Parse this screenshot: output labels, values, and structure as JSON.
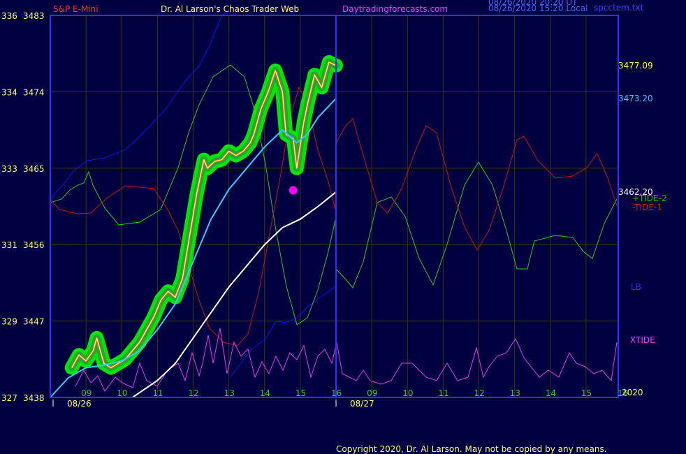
{
  "header": {
    "symbol": "S&P E-Mini",
    "title": "Dr. Al Larson's Chaos Trader Web",
    "site": "Daytradingforecasts.com",
    "stamp_line1": "08/26/2020 20:20 UT",
    "stamp_line2": "08/26/2020 15:20 Local",
    "file": "spcctem.txt"
  },
  "copyright": "Copyright 2020, Dr. Al Larson. May not be copied by any means.",
  "colors": {
    "background": "#000040",
    "plot_border": "#3030ff",
    "price": "#ffff00",
    "price_highlight": "#00ff00",
    "price_core": "#cc44cc",
    "average_cyan": "#33ccff",
    "average_white": "#ffffff",
    "channel": "#0000ff",
    "tide_plus": "#00cc00",
    "tide_minus": "#cc0000",
    "xtide": "#ff33ff",
    "marker": "#ff00ff"
  },
  "chart_data": {
    "type": "line",
    "x_unit": "hour (days 08/26 and 08/27)",
    "y_left_labels": [
      {
        "value": 3483,
        "code": "336"
      },
      {
        "value": 3474,
        "code": "334"
      },
      {
        "value": 3465,
        "code": "333"
      },
      {
        "value": 3456,
        "code": "331"
      },
      {
        "value": 3447,
        "code": "329"
      },
      {
        "value": 3438,
        "code": "327"
      }
    ],
    "ylim": [
      3438,
      3483
    ],
    "grid": true,
    "x_ticks_day1": [
      "09",
      "10",
      "11",
      "12",
      "13",
      "14",
      "15",
      "16"
    ],
    "x_ticks_day2": [
      "09",
      "10",
      "11",
      "12",
      "13",
      "14",
      "15",
      "16"
    ],
    "dates": [
      "08/26",
      "08/27"
    ],
    "right_labels": [
      {
        "text": "3477.09",
        "value": 3477.09,
        "color": "#ffff00"
      },
      {
        "text": "3473.20",
        "value": 3473.2,
        "color": "#33ccff"
      },
      {
        "text": "3462.20",
        "value": 3462.2,
        "color": "#ffffff"
      }
    ],
    "legend": [
      {
        "name": "+TIDE-2",
        "color": "#00cc00"
      },
      {
        "name": "-TIDE-1",
        "color": "#cc0000"
      },
      {
        "name": "LB",
        "color": "#0000ff"
      },
      {
        "name": "XTIDE",
        "color": "#ff33ff"
      }
    ],
    "year_label": "2020",
    "series": [
      {
        "name": "S&P E-Mini",
        "x": [
          8.6,
          8.8,
          9.0,
          9.2,
          9.3,
          9.5,
          9.7,
          9.9,
          10.1,
          10.3,
          10.5,
          10.7,
          10.9,
          11.1,
          11.3,
          11.5,
          11.7,
          11.9,
          12.1,
          12.3,
          12.4,
          12.6,
          12.8,
          13.0,
          13.2,
          13.4,
          13.6,
          13.7,
          13.9,
          14.1,
          14.3,
          14.5,
          14.6,
          14.8,
          14.9,
          15.1,
          15.2,
          15.4,
          15.6,
          15.8,
          16.0
        ],
        "y": [
          3441.5,
          3443.0,
          3442.3,
          3443.5,
          3445.0,
          3442.0,
          3441.5,
          3442.0,
          3442.5,
          3443.5,
          3444.5,
          3446.0,
          3447.5,
          3449.5,
          3450.5,
          3449.8,
          3452.0,
          3457.0,
          3462.0,
          3466.0,
          3465.0,
          3465.8,
          3466.0,
          3467.0,
          3466.5,
          3467.0,
          3468.0,
          3469.0,
          3472.0,
          3474.0,
          3476.5,
          3474.0,
          3469.0,
          3468.5,
          3465.0,
          3470.5,
          3472.5,
          3476.0,
          3474.5,
          3477.5,
          3477.1
        ]
      },
      {
        "name": "Cyan average",
        "x": [
          8.0,
          8.5,
          9.0,
          9.5,
          10.0,
          10.5,
          11.0,
          11.5,
          12.0,
          12.5,
          13.0,
          13.5,
          14.0,
          14.5,
          14.9,
          15.2,
          15.5,
          16.0
        ],
        "y": [
          3438.0,
          3440.3,
          3441.5,
          3441.8,
          3442.3,
          3443.5,
          3446.0,
          3449.0,
          3454.0,
          3459.0,
          3462.5,
          3465.0,
          3467.5,
          3469.5,
          3468.0,
          3469.0,
          3471.0,
          3473.2
        ]
      },
      {
        "name": "White average",
        "x": [
          10.3,
          11.0,
          11.5,
          12.0,
          12.5,
          13.0,
          13.5,
          14.0,
          14.5,
          15.0,
          15.5,
          16.0
        ],
        "y": [
          3438.0,
          3440.0,
          3442.0,
          3445.0,
          3448.0,
          3451.0,
          3453.5,
          3456.0,
          3458.0,
          3459.0,
          3460.5,
          3462.2
        ]
      }
    ],
    "annotations": [
      {
        "type": "point",
        "x": 14.8,
        "y": 3462.4,
        "color": "#ff00ff"
      }
    ]
  }
}
